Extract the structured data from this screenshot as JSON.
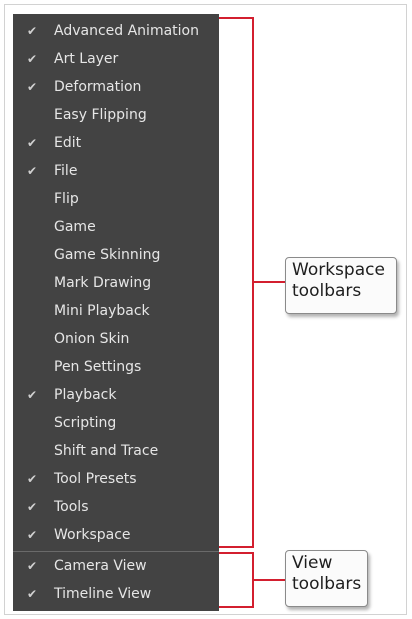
{
  "menu": {
    "items": [
      {
        "label": "Advanced Animation",
        "checked": true
      },
      {
        "label": "Art Layer",
        "checked": true
      },
      {
        "label": "Deformation",
        "checked": true
      },
      {
        "label": "Easy Flipping",
        "checked": false
      },
      {
        "label": "Edit",
        "checked": true
      },
      {
        "label": "File",
        "checked": true
      },
      {
        "label": "Flip",
        "checked": false
      },
      {
        "label": "Game",
        "checked": false
      },
      {
        "label": "Game Skinning",
        "checked": false
      },
      {
        "label": "Mark Drawing",
        "checked": false
      },
      {
        "label": "Mini Playback",
        "checked": false
      },
      {
        "label": "Onion Skin",
        "checked": false
      },
      {
        "label": "Pen Settings",
        "checked": false
      },
      {
        "label": "Playback",
        "checked": true
      },
      {
        "label": "Scripting",
        "checked": false
      },
      {
        "label": "Shift and Trace",
        "checked": false
      },
      {
        "label": "Tool Presets",
        "checked": true
      },
      {
        "label": "Tools",
        "checked": true
      },
      {
        "label": "Workspace",
        "checked": true
      },
      {
        "label": "Camera View",
        "checked": true
      },
      {
        "label": "Timeline View",
        "checked": true
      }
    ]
  },
  "check_mark": "✔",
  "callouts": {
    "workspace": {
      "line1": "Workspace",
      "line2": "toolbars"
    },
    "view": {
      "line1": "View",
      "line2": "toolbars"
    }
  },
  "colors": {
    "menu_bg": "#434343",
    "annotation_red": "#d31f2f"
  }
}
